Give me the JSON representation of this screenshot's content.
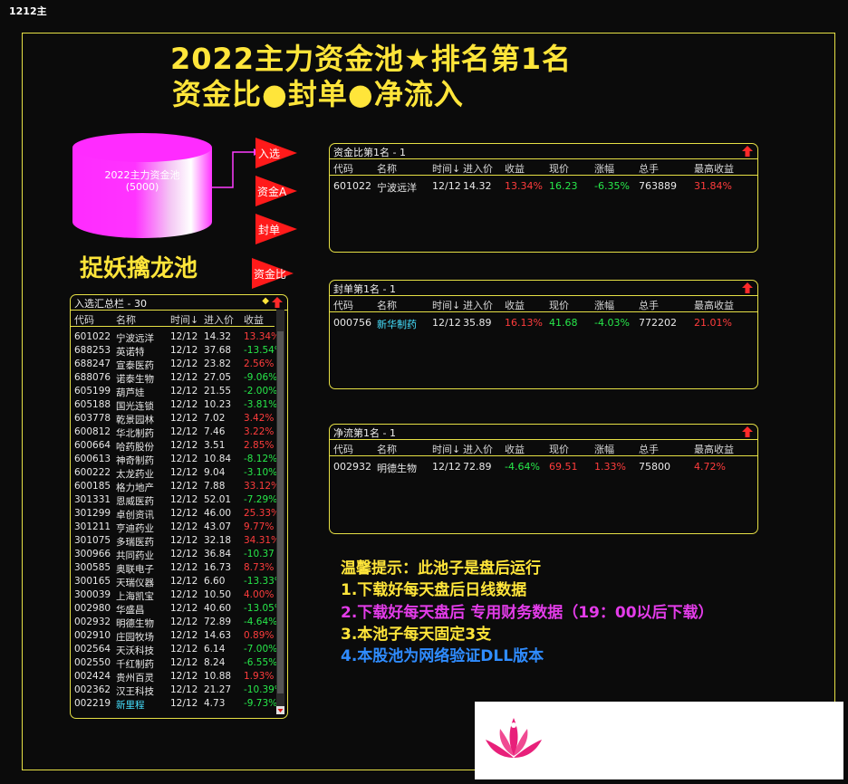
{
  "window_title": "1212主",
  "headline": {
    "line1": "2022主力资金池★排名第1名",
    "line2": "资金比●封单●净流入"
  },
  "cylinder": {
    "line1": "2022主力资金池",
    "line2": "(5000)"
  },
  "pool_title": "捉妖擒龙池",
  "flags": [
    {
      "label": "入选"
    },
    {
      "label": "资金A"
    },
    {
      "label": "封单"
    },
    {
      "label": "资金比"
    }
  ],
  "colors": {
    "accent": "#e6e045",
    "up": "#ff3c3c",
    "down": "#27e84a",
    "flag": "#ff1a1a",
    "cylinder": "#ff33ff"
  },
  "columns": [
    "代码",
    "名称",
    "时间↓",
    "进入价",
    "收益",
    "现价",
    "涨幅",
    "总手",
    "最高收益"
  ],
  "panels": [
    {
      "title": "资金比第1名 - 1",
      "rows": [
        {
          "code": "601022",
          "name": "宁波远洋",
          "time": "12/12",
          "price": "14.32",
          "ret": "13.34%",
          "cur": "16.23",
          "chg": "-6.35%",
          "vol": "763889",
          "max": "31.84%",
          "name_color": "white",
          "ret_color": "red",
          "chg_color": "green"
        }
      ]
    },
    {
      "title": "封单第1名 - 1",
      "rows": [
        {
          "code": "000756",
          "name": "新华制药",
          "time": "12/12",
          "price": "35.89",
          "ret": "16.13%",
          "cur": "41.68",
          "chg": "-4.03%",
          "vol": "772202",
          "max": "21.01%",
          "name_color": "cyan",
          "ret_color": "red",
          "chg_color": "green"
        }
      ]
    },
    {
      "title": "净流第1名 - 1",
      "rows": [
        {
          "code": "002932",
          "name": "明德生物",
          "time": "12/12",
          "price": "72.89",
          "ret": "-4.64%",
          "cur": "69.51",
          "chg": "1.33%",
          "vol": "75800",
          "max": "4.72%",
          "name_color": "white",
          "ret_color": "green",
          "chg_color": "red"
        }
      ]
    }
  ],
  "summary": {
    "title": "入选汇总栏 - 30",
    "diamond": "◆",
    "columns": [
      "代码",
      "名称",
      "时间↓",
      "进入价",
      "收益"
    ],
    "rows": [
      {
        "code": "601022",
        "name": "宁波远洋",
        "time": "12/12",
        "price": "14.32",
        "ret": "13.34%",
        "c": "red"
      },
      {
        "code": "688253",
        "name": "英诺特",
        "time": "12/12",
        "price": "37.68",
        "ret": "-13.54%",
        "c": "green"
      },
      {
        "code": "688247",
        "name": "宣泰医药",
        "time": "12/12",
        "price": "23.82",
        "ret": "2.56%",
        "c": "red"
      },
      {
        "code": "688076",
        "name": "诺泰生物",
        "time": "12/12",
        "price": "27.05",
        "ret": "-9.06%",
        "c": "green"
      },
      {
        "code": "605199",
        "name": "葫芦娃",
        "time": "12/12",
        "price": "21.55",
        "ret": "-2.00%",
        "c": "green"
      },
      {
        "code": "605188",
        "name": "国光连锁",
        "time": "12/12",
        "price": "10.23",
        "ret": "-3.81%",
        "c": "green"
      },
      {
        "code": "603778",
        "name": "乾景园林",
        "time": "12/12",
        "price": "7.02",
        "ret": "3.42%",
        "c": "red"
      },
      {
        "code": "600812",
        "name": "华北制药",
        "time": "12/12",
        "price": "7.46",
        "ret": "3.22%",
        "c": "red"
      },
      {
        "code": "600664",
        "name": "哈药股份",
        "time": "12/12",
        "price": "3.51",
        "ret": "2.85%",
        "c": "red"
      },
      {
        "code": "600613",
        "name": "神奇制药",
        "time": "12/12",
        "price": "10.84",
        "ret": "-8.12%",
        "c": "green"
      },
      {
        "code": "600222",
        "name": "太龙药业",
        "time": "12/12",
        "price": "9.04",
        "ret": "-3.10%",
        "c": "green"
      },
      {
        "code": "600185",
        "name": "格力地产",
        "time": "12/12",
        "price": "7.88",
        "ret": "33.12%",
        "c": "red"
      },
      {
        "code": "301331",
        "name": "恩威医药",
        "time": "12/12",
        "price": "52.01",
        "ret": "-7.29%",
        "c": "green"
      },
      {
        "code": "301299",
        "name": "卓创资讯",
        "time": "12/12",
        "price": "46.00",
        "ret": "25.33%",
        "c": "red"
      },
      {
        "code": "301211",
        "name": "亨迪药业",
        "time": "12/12",
        "price": "43.07",
        "ret": "9.77%",
        "c": "red"
      },
      {
        "code": "301075",
        "name": "多瑞医药",
        "time": "12/12",
        "price": "32.18",
        "ret": "34.31%",
        "c": "red"
      },
      {
        "code": "300966",
        "name": "共同药业",
        "time": "12/12",
        "price": "36.84",
        "ret": "-10.37",
        "c": "green"
      },
      {
        "code": "300585",
        "name": "奥联电子",
        "time": "12/12",
        "price": "16.73",
        "ret": "8.73%",
        "c": "red"
      },
      {
        "code": "300165",
        "name": "天瑞仪器",
        "time": "12/12",
        "price": "6.60",
        "ret": "-13.33%",
        "c": "green"
      },
      {
        "code": "300039",
        "name": "上海凯宝",
        "time": "12/12",
        "price": "10.50",
        "ret": "4.00%",
        "c": "red"
      },
      {
        "code": "002980",
        "name": "华盛昌",
        "time": "12/12",
        "price": "40.60",
        "ret": "-13.05%",
        "c": "green"
      },
      {
        "code": "002932",
        "name": "明德生物",
        "time": "12/12",
        "price": "72.89",
        "ret": "-4.64%",
        "c": "green"
      },
      {
        "code": "002910",
        "name": "庄园牧场",
        "time": "12/12",
        "price": "14.63",
        "ret": "0.89%",
        "c": "red"
      },
      {
        "code": "002564",
        "name": "天沃科技",
        "time": "12/12",
        "price": "6.14",
        "ret": "-7.00%",
        "c": "green"
      },
      {
        "code": "002550",
        "name": "千红制药",
        "time": "12/12",
        "price": "8.24",
        "ret": "-6.55%",
        "c": "green"
      },
      {
        "code": "002424",
        "name": "贵州百灵",
        "time": "12/12",
        "price": "10.88",
        "ret": "1.93%",
        "c": "red"
      },
      {
        "code": "002362",
        "name": "汉王科技",
        "time": "12/12",
        "price": "21.27",
        "ret": "-10.39%",
        "c": "green"
      },
      {
        "code": "002219",
        "name": "新里程",
        "time": "12/12",
        "price": "4.73",
        "ret": "-9.73%",
        "c": "green",
        "nc": "cyan"
      }
    ]
  },
  "tips": {
    "title": "温馨提示：此池子是盘后运行",
    "item1": "1.下载好每天盘后日线数据",
    "item2": "2.下载好每天盘后 专用财务数据（19：00以后下载）",
    "item3": "3.本池子每天固定3支",
    "item4": "4.本股池为网络验证DLL版本"
  }
}
